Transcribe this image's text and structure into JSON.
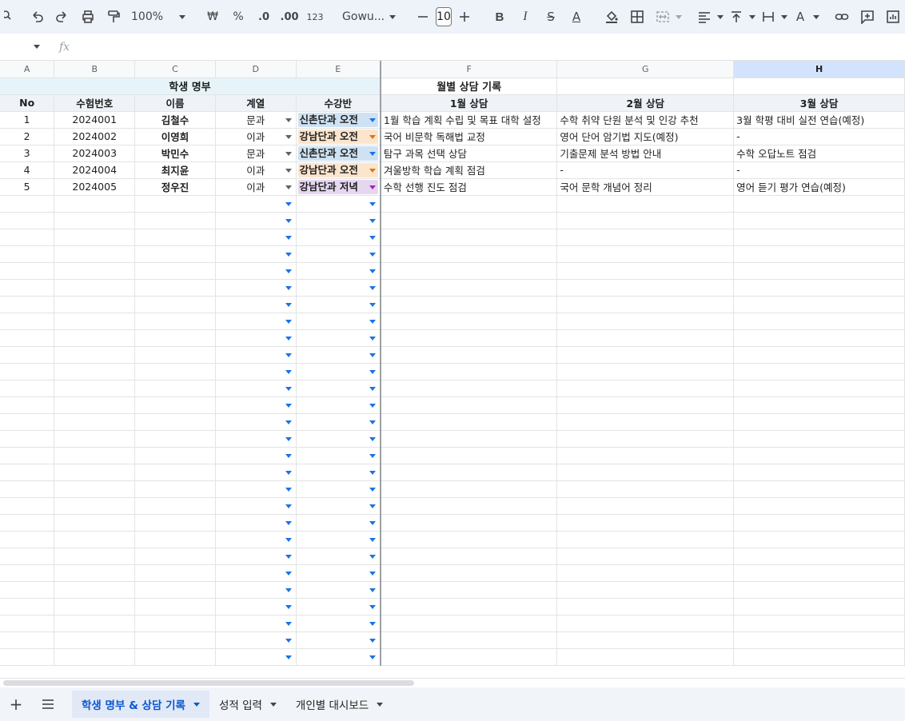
{
  "toolbar": {
    "zoom": "100%",
    "currency": "₩",
    "percent": "%",
    "decrease_decimal": ".0",
    "increase_decimal": ".00",
    "number_format": "123",
    "font": "Gowu...",
    "font_size": "10"
  },
  "columns": [
    "A",
    "B",
    "C",
    "D",
    "E",
    "F",
    "G",
    "H"
  ],
  "selected_column": "H",
  "titles": {
    "roster": "학생 명부",
    "counsel": "월별 상담 기록"
  },
  "headers": [
    "No",
    "수험번호",
    "이름",
    "계열",
    "수강반",
    "1월 상담",
    "2월 상담",
    "3월 상담"
  ],
  "rows": [
    {
      "no": "1",
      "id": "2024001",
      "name": "김철수",
      "track": "문과",
      "class": "신촌단과 오전",
      "m1": "1월 학습 계획 수립 및 목표 대학 설정",
      "m2": "수학 취약 단원 분석 및 인강 추천",
      "m3": "3월 학평 대비 실전 연습(예정)",
      "color": "#cfe2f3",
      "arrow": "blue"
    },
    {
      "no": "2",
      "id": "2024002",
      "name": "이영희",
      "track": "이과",
      "class": "강남단과 오전",
      "m1": "국어 비문학 독해법 교정",
      "m2": "영어 단어 암기법 지도(예정)",
      "m3": "-",
      "color": "#fce5cd",
      "arrow": "orange"
    },
    {
      "no": "3",
      "id": "2024003",
      "name": "박민수",
      "track": "문과",
      "class": "신촌단과 오전",
      "m1": "탐구 과목 선택 상담",
      "m2": "기출문제 분석 방법 안내",
      "m3": "수학 오답노트 점검",
      "color": "#cfe2f3",
      "arrow": "blue"
    },
    {
      "no": "4",
      "id": "2024004",
      "name": "최지윤",
      "track": "이과",
      "class": "강남단과 오전",
      "m1": "겨울방학 학습 계획 점검",
      "m2": "-",
      "m3": "-",
      "color": "#fce5cd",
      "arrow": "orange"
    },
    {
      "no": "5",
      "id": "2024005",
      "name": "정우진",
      "track": "이과",
      "class": "강남단과 저녁",
      "m1": "수학 선행 진도 점검",
      "m2": "국어 문학 개념어 정리",
      "m3": "영어 듣기 평가 연습(예정)",
      "color": "#e6d7f0",
      "arrow": "purple"
    }
  ],
  "empty_rows": 28,
  "sheet_tabs": [
    {
      "label": "학생 명부 & 상담 기록",
      "active": true
    },
    {
      "label": "성적 입력",
      "active": false
    },
    {
      "label": "개인별 대시보드",
      "active": false
    }
  ],
  "formula_bar": {
    "fx": "fx"
  }
}
